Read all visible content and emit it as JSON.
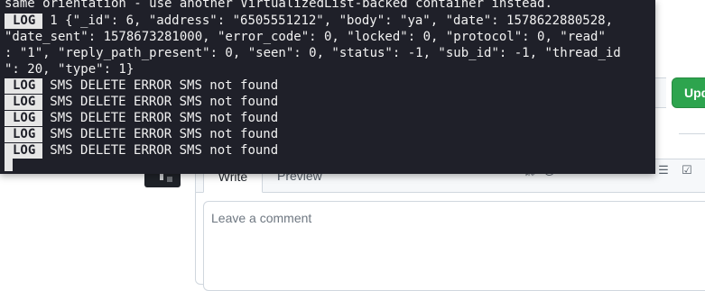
{
  "background": {
    "update_button_label": "Upd",
    "editor": {
      "tab_write": "Write",
      "tab_preview": "Preview",
      "placeholder": "Leave a comment",
      "toolbar_icons": [
        "quote-icon",
        "code-icon",
        "link-icon",
        "mention-icon",
        "image-icon",
        "ordered-list-icon",
        "unordered-list-icon",
        "task-list-icon"
      ]
    }
  },
  "terminal": {
    "lines": [
      "same orientation - use another VirtualizedList-backed container instead.",
      "1 {\"_id\": 6, \"address\": \"6505551212\", \"body\": \"ya\", \"date\": 1578622880528,",
      "\"date_sent\": 1578673281000, \"error_code\": 0, \"locked\": 0, \"protocol\": 0, \"read\"",
      ": \"1\", \"reply_path_present\": 0, \"seen\": 0, \"status\": -1, \"sub_id\": -1, \"thread_id",
      "\": 20, \"type\": 1}",
      "SMS DELETE ERROR SMS not found",
      "SMS DELETE ERROR SMS not found",
      "SMS DELETE ERROR SMS not found",
      "SMS DELETE ERROR SMS not found",
      "SMS DELETE ERROR SMS not found"
    ],
    "badge_label": "LOG"
  },
  "colors": {
    "terminal_bg": "#1f2029",
    "terminal_text": "#f2f2f2",
    "badge_bg": "#e6e6e6",
    "primary_button": "#2da44e"
  }
}
